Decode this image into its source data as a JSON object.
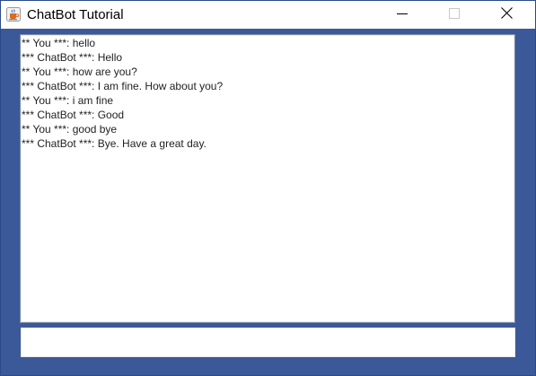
{
  "window": {
    "title": "ChatBot Tutorial",
    "icon": "java-coffee-cup-icon"
  },
  "controls": {
    "minimize_icon": "minimize-icon",
    "maximize_icon": "maximize-icon",
    "close_icon": "close-icon"
  },
  "chat": {
    "lines": [
      "** You ***: hello",
      "*** ChatBot ***: Hello",
      "** You ***: how are you?",
      "*** ChatBot ***: I am fine. How about you?",
      "** You ***: i am fine",
      "*** ChatBot ***: Good",
      "** You ***: good bye",
      "*** ChatBot ***: Bye. Have a great day."
    ]
  },
  "input": {
    "value": ""
  },
  "colors": {
    "background": "#3b5998",
    "titlebar": "#ffffff"
  }
}
